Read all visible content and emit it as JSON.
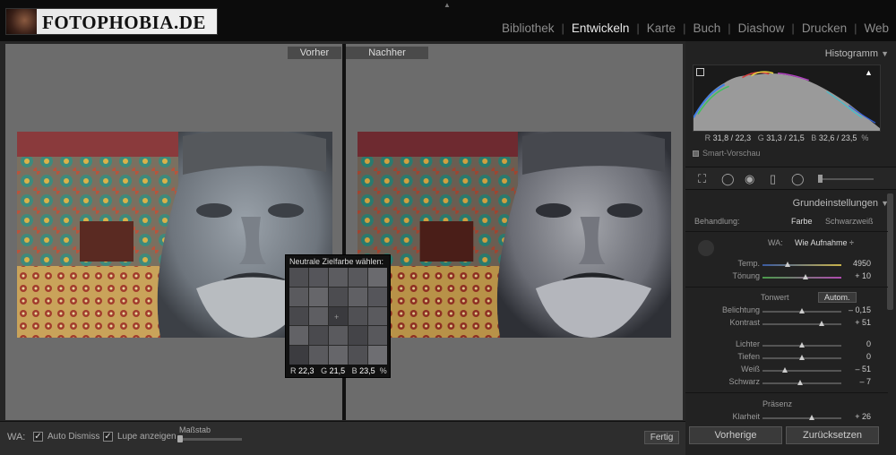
{
  "brand": {
    "logo_text": "FOTOPHOBIA.DE"
  },
  "modules": [
    "Bibliothek",
    "Entwickeln",
    "Karte",
    "Buch",
    "Diashow",
    "Drucken",
    "Web"
  ],
  "active_module": "Entwickeln",
  "view": {
    "before_label": "Vorher",
    "after_label": "Nachher"
  },
  "loupe": {
    "title": "Neutrale Zielfarbe wählen:",
    "r_label": "R",
    "r": "22,3",
    "g_label": "G",
    "g": "21,5",
    "b_label": "B",
    "b": "23,5",
    "unit": "%"
  },
  "toolbar": {
    "wa_label": "WA:",
    "auto_dismiss_label": "Auto Dismiss",
    "auto_dismiss_checked": true,
    "lupe_label": "Lupe anzeigen",
    "lupe_checked": true,
    "massstab_label": "Maßstab",
    "massstab_level": 0.0,
    "done_label": "Fertig"
  },
  "histogram": {
    "title": "Histogramm",
    "r_label": "R",
    "r": "31,8 / 22,3",
    "g_label": "G",
    "g": "31,3 / 21,5",
    "b_label": "B",
    "b": "32,6 / 23,5",
    "unit": "%",
    "smart_preview": "Smart-Vorschau"
  },
  "basic": {
    "title": "Grundeinstellungen",
    "treatment_label": "Behandlung:",
    "color_label": "Farbe",
    "bw_label": "Schwarzweiß",
    "wa_label": "WA:",
    "wa_value": "Wie Aufnahme",
    "temp_label": "Temp.",
    "temp_value": "4950",
    "tint_label": "Tönung",
    "tint_value": "+ 10",
    "tone_label": "Tonwert",
    "auto_label": "Autom.",
    "exposure_label": "Belichtung",
    "exposure_value": "– 0,15",
    "contrast_label": "Kontrast",
    "contrast_value": "+ 51",
    "highlights_label": "Lichter",
    "highlights_value": "0",
    "shadows_label": "Tiefen",
    "shadows_value": "0",
    "whites_label": "Weiß",
    "whites_value": "– 51",
    "blacks_label": "Schwarz",
    "blacks_value": "– 7",
    "presence_label": "Präsenz",
    "clarity_label": "Klarheit",
    "clarity_value": "+ 26"
  },
  "panel_buttons": {
    "previous": "Vorherige",
    "reset": "Zurücksetzen"
  }
}
